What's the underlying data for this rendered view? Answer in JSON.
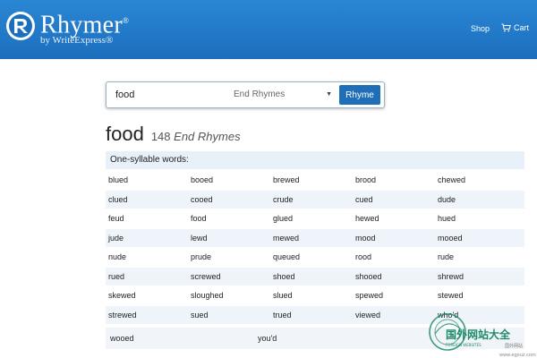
{
  "header": {
    "brand": "Rhymer",
    "brand_mark": "®",
    "subtitle": "by WriteExpress®",
    "nav": {
      "shop": "Shop",
      "cart": "Cart"
    }
  },
  "search": {
    "query": "food",
    "rhyme_type": "End Rhymes",
    "button": "Rhyme"
  },
  "result": {
    "word": "food",
    "count": "148",
    "type": "End Rhymes"
  },
  "section": {
    "title": "One-syllable words:",
    "rows": [
      [
        "blued",
        "booed",
        "brewed",
        "brood",
        "chewed"
      ],
      [
        "clued",
        "cooed",
        "crude",
        "cued",
        "dude"
      ],
      [
        "feud",
        "food",
        "glued",
        "hewed",
        "hued"
      ],
      [
        "jude",
        "lewd",
        "mewed",
        "mood",
        "mooed"
      ],
      [
        "nude",
        "prude",
        "queued",
        "rood",
        "rude"
      ],
      [
        "rued",
        "screwed",
        "shoed",
        "shooed",
        "shrewd"
      ],
      [
        "skewed",
        "sloughed",
        "slued",
        "spewed",
        "stewed"
      ],
      [
        "strewed",
        "sued",
        "trued",
        "viewed",
        "who'd"
      ]
    ],
    "extra_row": [
      "wooed",
      "you'd"
    ]
  },
  "watermark": {
    "line1": "国外网站大全",
    "line2": "FOREIGN WEBSITES",
    "line3": "国外网站",
    "url": "www.egouz.com"
  },
  "colors": {
    "header": "#1b6fbd",
    "button": "#1f6fb8",
    "row_alt": "#eef4fa",
    "watermark": "#1f8a6a"
  },
  "icons": {
    "logo": "rhymer-logo-icon",
    "cart": "cart-icon",
    "dropdown": "chevron-down-icon"
  }
}
